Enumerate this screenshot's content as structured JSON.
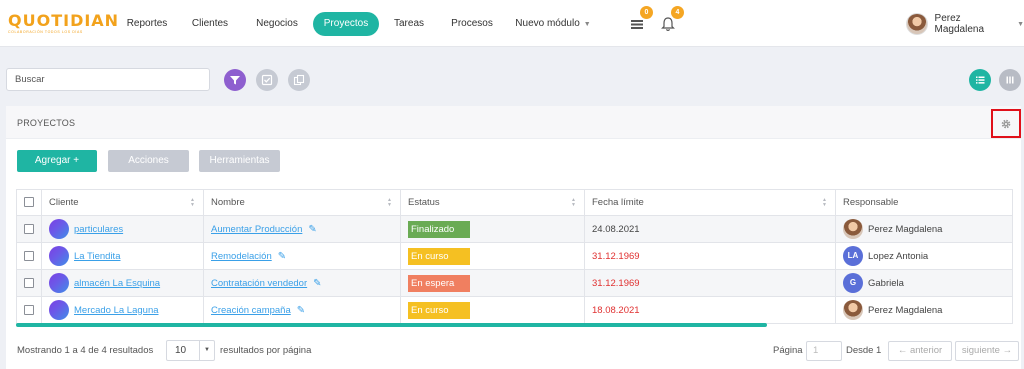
{
  "brand": {
    "logo_text": "QUOTIDIAN",
    "tagline": "COLABORACIÓN TODOS LOS DÍAS"
  },
  "nav": {
    "items": [
      {
        "label": "Reportes"
      },
      {
        "label": "Clientes"
      },
      {
        "label": "Negocios"
      },
      {
        "label": "Proyectos",
        "active": true
      },
      {
        "label": "Tareas"
      },
      {
        "label": "Procesos"
      },
      {
        "label": "Nuevo módulo"
      }
    ],
    "list_badge": "0",
    "bell_badge": "4",
    "user_name": "Perez Magdalena"
  },
  "toolbar": {
    "search_placeholder": "Buscar"
  },
  "panel": {
    "title": "PROYECTOS",
    "buttons": {
      "add": "Agregar +",
      "actions": "Acciones",
      "tools": "Herramientas"
    }
  },
  "table": {
    "columns": [
      "Cliente",
      "Nombre",
      "Estatus",
      "Fecha límite",
      "Responsable"
    ],
    "rows": [
      {
        "client": "particulares",
        "name": "Aumentar Producción",
        "status": "Finalizado",
        "date": "24.08.2021",
        "owner": "Perez Magdalena",
        "owner_initials": ""
      },
      {
        "client": "La Tiendita",
        "name": "Remodelación",
        "status": "En curso",
        "date": "31.12.1969",
        "owner": "Lopez Antonia",
        "owner_initials": "LA"
      },
      {
        "client": "almacén La Esquina",
        "name": "Contratación vendedor",
        "status": "En espera",
        "date": "31.12.1969",
        "owner": "Gabriela",
        "owner_initials": "G"
      },
      {
        "client": "Mercado La Laguna",
        "name": "Creación campaña",
        "status": "En curso",
        "date": "18.08.2021",
        "owner": "Perez Magdalena",
        "owner_initials": ""
      }
    ]
  },
  "footer": {
    "showing": "Mostrando 1 a 4 de 4 resultados",
    "page_size": "10",
    "per_page": "resultados por página",
    "page_label": "Página",
    "page_value": "1",
    "from_label": "Desde",
    "total_pages": "1",
    "prev": "← anterior",
    "next": "siguiente →"
  },
  "colors": {
    "accent": "#1fb5a3",
    "filter": "#8e5fcf",
    "status_finalizado": "#6aab54",
    "status_en_curso": "#f5c022",
    "status_en_espera": "#f07f60",
    "date_overdue": "#e03131",
    "highlight_box": "#e0101a"
  }
}
